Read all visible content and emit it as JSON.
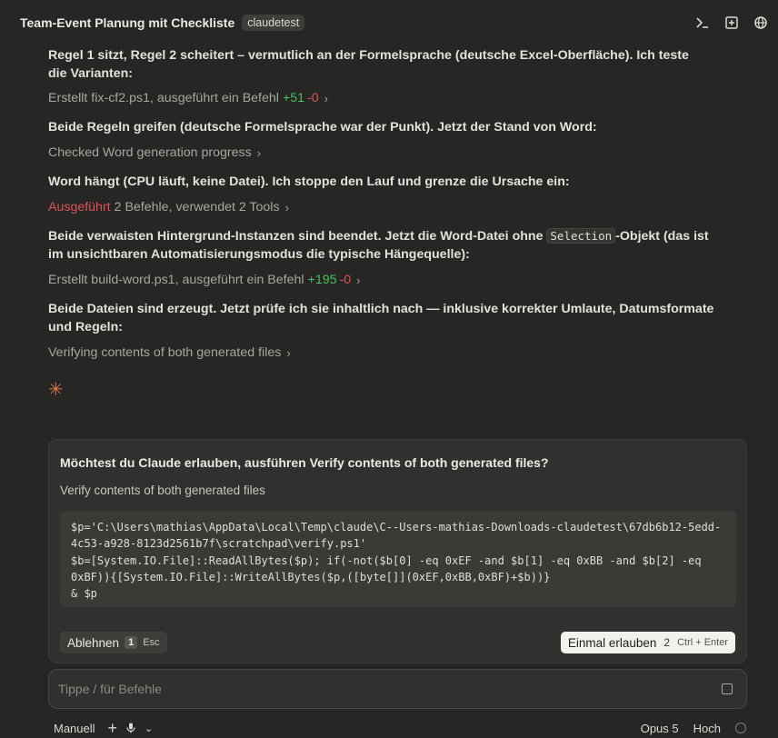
{
  "header": {
    "title": "Team-Event Planung mit Checkliste",
    "badge": "claudetest",
    "icons": [
      "terminal-icon",
      "window-icon",
      "globe-icon"
    ]
  },
  "chat": {
    "p1": "Regel 1 sitzt, Regel 2 scheitert – vermutlich an der Formelsprache (deutsche Excel-Oberfläche). Ich teste die Varianten:",
    "step1": {
      "text": "Erstellt fix-cf2.ps1, ausgeführt ein Befehl",
      "plus": "+51",
      "minus": "-0"
    },
    "p2": "Beide Regeln greifen (deutsche Formelsprache war der Punkt). Jetzt der Stand von Word:",
    "step2": {
      "text": "Checked Word generation progress"
    },
    "p3": "Word hängt (CPU läuft, keine Datei). Ich stoppe den Lauf und grenze die Ursache ein:",
    "step3": {
      "status": "Ausgeführt",
      "text": "2 Befehle, verwendet 2 Tools"
    },
    "p4_a": "Beide verwaisten Hintergrund-Instanzen sind beendet. Jetzt die Word-Datei ohne ",
    "p4_code": "Selection",
    "p4_b": "-Objekt (das ist im unsichtbaren Automatisierungsmodus die typische Hängequelle):",
    "step4": {
      "text": "Erstellt build-word.ps1, ausgeführt ein Befehl",
      "plus": "+195",
      "minus": "-0"
    },
    "p5": "Beide Dateien sind erzeugt. Jetzt prüfe ich sie inhaltlich nach — inklusive korrekter Umlaute, Datumsformate und Regeln:",
    "step5": {
      "text": "Verifying contents of both generated files"
    }
  },
  "permission": {
    "title": "Möchtest du Claude erlauben, ausführen Verify contents of both generated files?",
    "subtitle": "Verify contents of both generated files",
    "code": "$p='C:\\Users\\mathias\\AppData\\Local\\Temp\\claude\\C--Users-mathias-Downloads-claudetest\\67db6b12-5edd-\n4c53-a928-8123d2561b7f\\scratchpad\\verify.ps1'\n$b=[System.IO.File]::ReadAllBytes($p); if(-not($b[0] -eq 0xEF -and $b[1] -eq 0xBB -and $b[2] -eq\n0xBF)){[System.IO.File]::WriteAllBytes($p,([byte[]](0xEF,0xBB,0xBF)+$b))}\n& $p",
    "deny_label": "Ablehnen",
    "deny_key": "1",
    "deny_shortcut": "Esc",
    "allow_label": "Einmal erlauben",
    "allow_key": "2",
    "allow_shortcut": "Ctrl + Enter"
  },
  "input": {
    "placeholder": "Tippe / für Befehle"
  },
  "footer": {
    "mode": "Manuell",
    "model": "Opus 5",
    "effort": "Hoch"
  },
  "colors": {
    "background": "#262624",
    "accent": "#d9734c",
    "added": "#4fbf5f",
    "removed": "#e0525a"
  }
}
